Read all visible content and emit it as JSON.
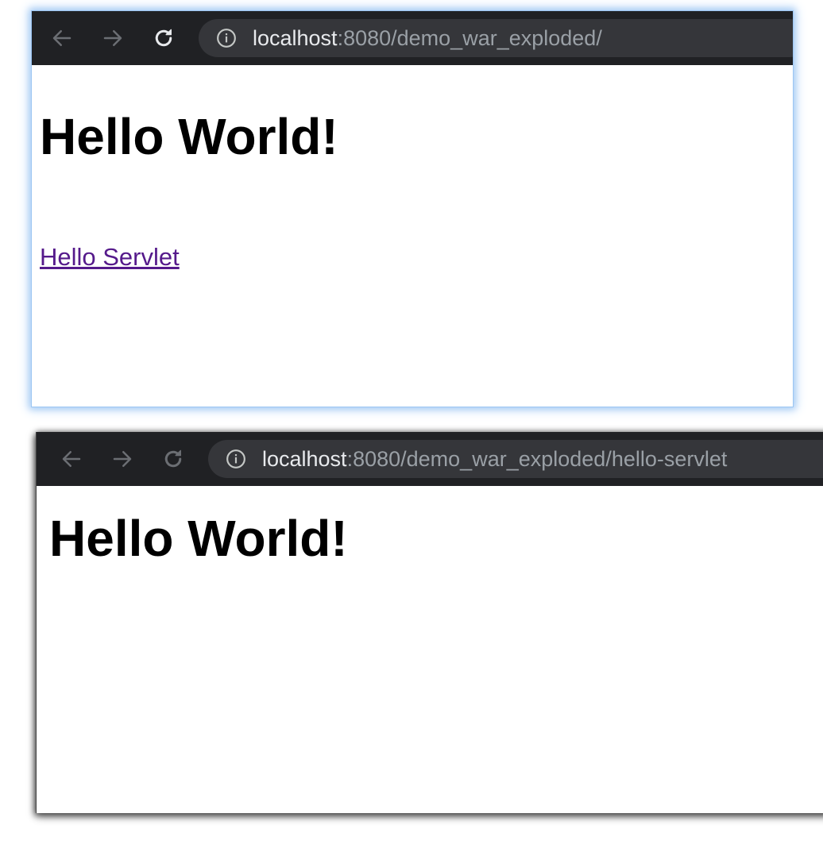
{
  "windows": [
    {
      "url": {
        "host": "localhost",
        "path": ":8080/demo_war_exploded/"
      },
      "heading": "Hello World!",
      "link_text": "Hello Servlet"
    },
    {
      "url": {
        "host": "localhost",
        "path": ":8080/demo_war_exploded/hello-servlet"
      },
      "heading": "Hello World!"
    }
  ],
  "icons": {
    "back": "arrow-left",
    "forward": "arrow-right",
    "reload": "reload-circular-arrow",
    "site_info": "info-circle"
  },
  "colors": {
    "toolbar_bg": "#202124",
    "omnibox_bg": "#35363a",
    "url_host": "#e8eaed",
    "url_path": "#9aa0a6",
    "visited_link": "#551a8b"
  }
}
